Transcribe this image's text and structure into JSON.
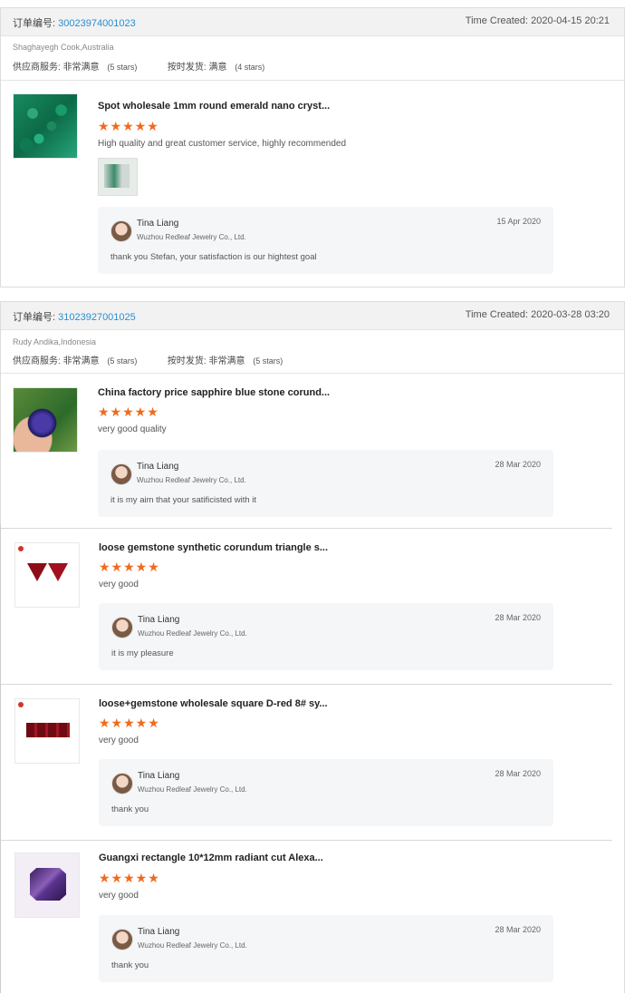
{
  "orders": [
    {
      "order_label": "订单编号:",
      "order_no": "30023974001023",
      "time_created": "Time Created: 2020-04-15 20:21",
      "buyer": "Shaghayegh Cook,Australia",
      "service_label": "供应商服务:",
      "service_value": "非常满意",
      "service_stars": "(5 stars)",
      "ontime_label": "按时发货:",
      "ontime_value": "满意",
      "ontime_stars": "(4 stars)",
      "items": [
        {
          "title": "Spot wholesale 1mm round emerald nano cryst...",
          "rating": 5,
          "stars_text": "★★★★★",
          "comment": "High quality and great customer service, highly recommended",
          "reply": {
            "name": "Tina Liang",
            "company": "Wuzhou Redleaf Jewelry Co., Ltd.",
            "date": "15 Apr 2020",
            "text": "thank you Stefan, your satisfaction is our hightest goal"
          }
        }
      ]
    },
    {
      "order_label": "订单编号:",
      "order_no": "31023927001025",
      "time_created": "Time Created: 2020-03-28 03:20",
      "buyer": "Rudy Andika,Indonesia",
      "service_label": "供应商服务:",
      "service_value": "非常满意",
      "service_stars": "(5 stars)",
      "ontime_label": "按时发货:",
      "ontime_value": "非常满意",
      "ontime_stars": "(5 stars)",
      "items": [
        {
          "title": "China factory price sapphire blue stone corund...",
          "rating": 5,
          "stars_text": "★★★★★",
          "comment": "very good quality",
          "reply": {
            "name": "Tina Liang",
            "company": "Wuzhou Redleaf Jewelry Co., Ltd.",
            "date": "28 Mar 2020",
            "text": "it is my aim that your satificisted with it"
          }
        },
        {
          "title": "loose gemstone synthetic corundum triangle s...",
          "rating": 5,
          "stars_text": "★★★★★",
          "comment": "very good",
          "reply": {
            "name": "Tina Liang",
            "company": "Wuzhou Redleaf Jewelry Co., Ltd.",
            "date": "28 Mar 2020",
            "text": "it is my pleasure"
          }
        },
        {
          "title": "loose+gemstone wholesale square D-red 8# sy...",
          "rating": 5,
          "stars_text": "★★★★★",
          "comment": "very good",
          "reply": {
            "name": "Tina Liang",
            "company": "Wuzhou Redleaf Jewelry Co., Ltd.",
            "date": "28 Mar 2020",
            "text": "thank you"
          }
        },
        {
          "title": "Guangxi rectangle 10*12mm radiant cut Alexa...",
          "rating": 5,
          "stars_text": "★★★★★",
          "comment": "very good",
          "reply": {
            "name": "Tina Liang",
            "company": "Wuzhou Redleaf Jewelry Co., Ltd.",
            "date": "28 Mar 2020",
            "text": "thank you"
          }
        }
      ]
    }
  ],
  "colors": {
    "link": "#2a8fd0",
    "star": "#f06a1c",
    "header_bg": "#f2f2f2",
    "reply_bg": "#f5f6f8"
  },
  "icons": {
    "avatar": "seller-avatar",
    "star": "star-icon"
  }
}
